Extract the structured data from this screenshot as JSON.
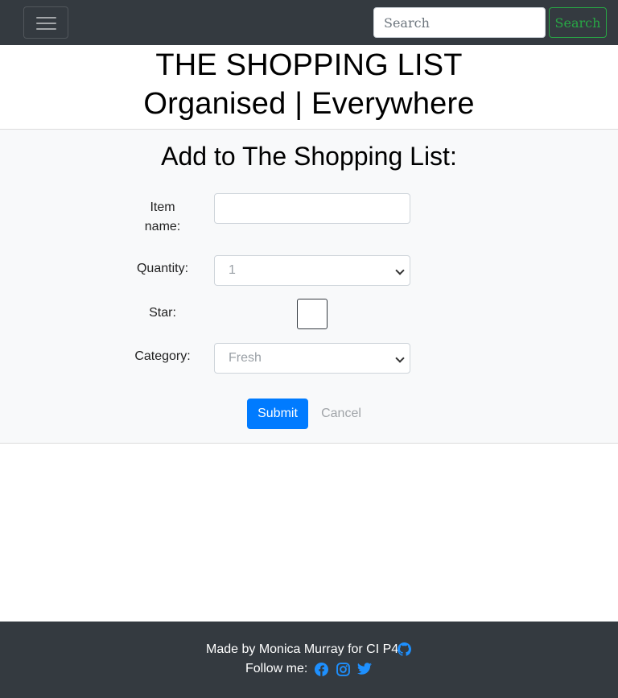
{
  "navbar": {
    "search_placeholder": "Search",
    "search_button": "Search",
    "toggler_icon": "hamburger-menu-icon"
  },
  "hero": {
    "line1": "THE SHOPPING LIST",
    "line2": "Organised | Everywhere"
  },
  "form": {
    "title": "Add to The Shopping List:",
    "item_name_label": "Item name:",
    "item_name_value": "",
    "quantity_label": "Quantity:",
    "quantity_selected": "1",
    "star_label": "Star:",
    "star_checked": false,
    "category_label": "Category:",
    "category_selected": "Fresh",
    "submit_label": "Submit",
    "cancel_label": "Cancel"
  },
  "footer": {
    "credit": "Made by Monica Murray for CI P4",
    "follow": "Follow me:",
    "icons": [
      "github-icon",
      "facebook-icon",
      "instagram-icon",
      "twitter-icon"
    ]
  },
  "colors": {
    "navbar_bg": "#343a40",
    "search_button": "#28a745",
    "submit_button": "#007bff",
    "social_icons": "#1e90ff"
  }
}
